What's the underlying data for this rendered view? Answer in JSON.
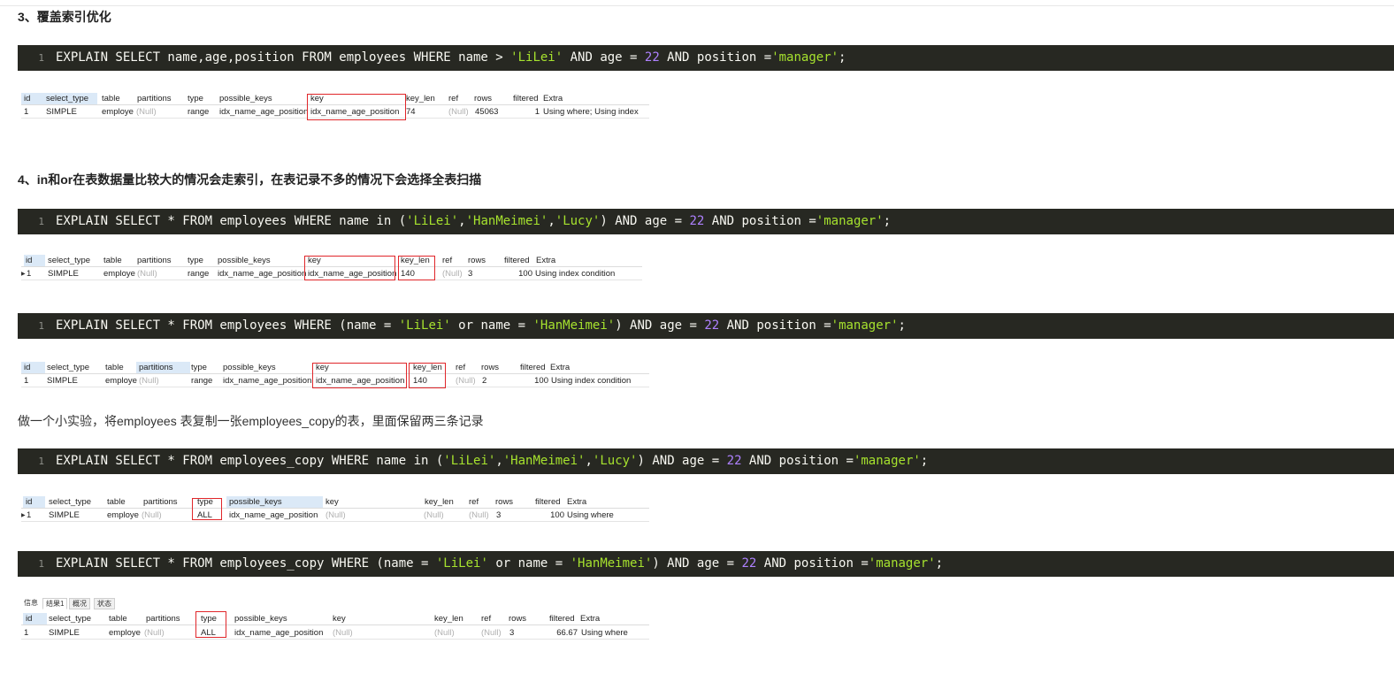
{
  "sections": {
    "h3": "3、覆盖索引优化",
    "h4": "4、in和or在表数据量比较大的情况会走索引，在表记录不多的情况下会选择全表扫描",
    "note": "做一个小实验，将employees 表复制一张employees_copy的表，里面保留两三条记录"
  },
  "code": {
    "line_no": "1",
    "q1": {
      "a": "EXPLAIN SELECT name,age,position FROM employees WHERE name > ",
      "s1": "'LiLei'",
      "b": " AND age = ",
      "n1": "22",
      "c": " AND position =",
      "s2": "'manager'",
      "d": ";"
    },
    "q2": {
      "a": "EXPLAIN SELECT * FROM employees WHERE name in (",
      "s1": "'LiLei'",
      "b1": ",",
      "s2": "'HanMeimei'",
      "b2": ",",
      "s3": "'Lucy'",
      "b": ") AND age = ",
      "n1": "22",
      "c": " AND position =",
      "s4": "'manager'",
      "d": ";"
    },
    "q3": {
      "a": "EXPLAIN SELECT * FROM employees WHERE (name = ",
      "s1": "'LiLei'",
      "b1": " or name = ",
      "s2": "'HanMeimei'",
      "b": ") AND age = ",
      "n1": "22",
      "c": " AND position =",
      "s3": "'manager'",
      "d": ";"
    },
    "q4": {
      "a": "EXPLAIN SELECT * FROM employees_copy WHERE name in (",
      "s1": "'LiLei'",
      "b1": ",",
      "s2": "'HanMeimei'",
      "b2": ",",
      "s3": "'Lucy'",
      "b": ") AND age = ",
      "n1": "22",
      "c": " AND position =",
      "s4": "'manager'",
      "d": ";"
    },
    "q5": {
      "a": "EXPLAIN SELECT * FROM employees_copy WHERE (name = ",
      "s1": "'LiLei'",
      "b1": " or name = ",
      "s2": "'HanMeimei'",
      "b": ") AND age = ",
      "n1": "22",
      "c": " AND position =",
      "s3": "'manager'",
      "d": ";"
    }
  },
  "headers": [
    "id",
    "select_type",
    "table",
    "partitions",
    "type",
    "possible_keys",
    "key",
    "key_len",
    "ref",
    "rows",
    "filtered",
    "Extra"
  ],
  "results": {
    "r1": [
      "1",
      "SIMPLE",
      "employe",
      "(Null)",
      "range",
      "idx_name_age_position",
      "idx_name_age_position",
      "74",
      "(Null)",
      "45063",
      "1",
      "Using where; Using index"
    ],
    "r2": [
      "1",
      "SIMPLE",
      "employe",
      "(Null)",
      "range",
      "idx_name_age_position",
      "idx_name_age_position",
      "140",
      "(Null)",
      "3",
      "100",
      "Using index condition"
    ],
    "r3": [
      "1",
      "SIMPLE",
      "employe",
      "(Null)",
      "range",
      "idx_name_age_position",
      "idx_name_age_position",
      "140",
      "(Null)",
      "2",
      "100",
      "Using index condition"
    ],
    "r4": [
      "1",
      "SIMPLE",
      "employe",
      "(Null)",
      "ALL",
      "idx_name_age_position",
      "(Null)",
      "(Null)",
      "(Null)",
      "3",
      "100",
      "Using where"
    ],
    "r5": [
      "1",
      "SIMPLE",
      "employe",
      "(Null)",
      "ALL",
      "idx_name_age_position",
      "(Null)",
      "(Null)",
      "(Null)",
      "3",
      "66.67",
      "Using where"
    ]
  },
  "tabs": [
    "信息",
    "结果1",
    "概况",
    "状态"
  ],
  "colors": {
    "code_bg": "#272822",
    "string": "#a6e22e",
    "number": "#ae81ff",
    "highlight_box": "#e0262a"
  }
}
